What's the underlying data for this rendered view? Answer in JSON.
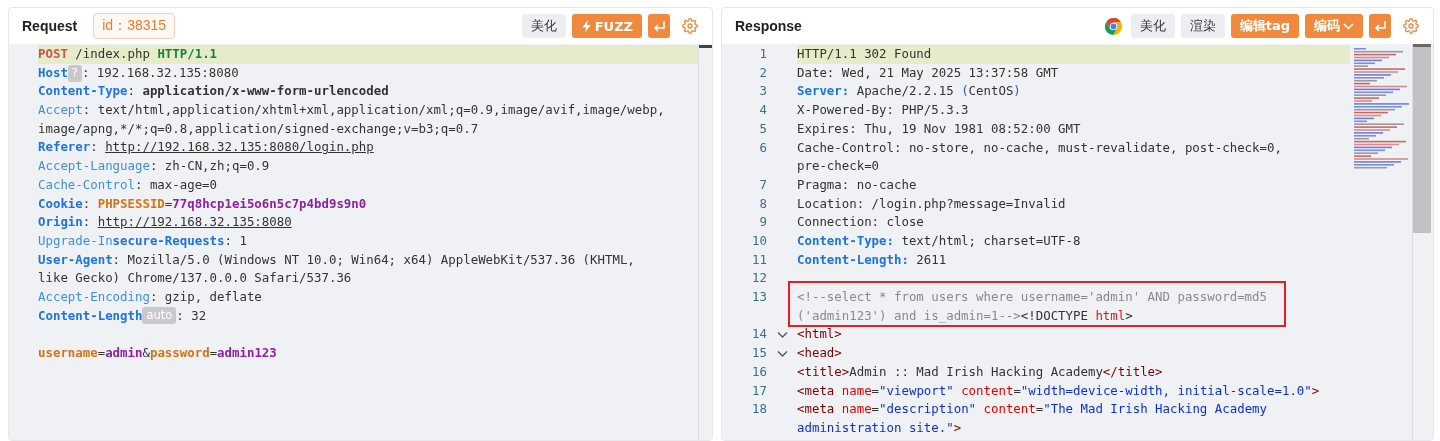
{
  "request": {
    "title": "Request",
    "id_badge": "id：38315",
    "buttons": [
      {
        "kind": "plain",
        "label": "美化"
      },
      {
        "kind": "fuzz",
        "label": "FUZZ"
      },
      {
        "kind": "wrap"
      },
      {
        "kind": "settings"
      }
    ],
    "lines": [
      {
        "highlighted": true,
        "wrapped": [
          [
            {
              "kind": "method",
              "text": "POST"
            },
            {
              "kind": "plain",
              "text": " /index.php "
            },
            {
              "kind": "version",
              "text": "HTTP/1.1"
            }
          ]
        ]
      },
      {
        "highlighted": false,
        "wrapped": [
          [
            {
              "kind": "key-strong",
              "text": "Host"
            },
            {
              "kind": "badge",
              "text": "?"
            },
            {
              "kind": "plain",
              "text": ": 192.168.32.135:8080"
            }
          ]
        ]
      },
      {
        "highlighted": false,
        "wrapped": [
          [
            {
              "kind": "key-strong",
              "text": "Content-Type"
            },
            {
              "kind": "plain",
              "text": ": "
            },
            {
              "kind": "value-strong",
              "text": "application/x-www-form-urlencoded"
            }
          ]
        ]
      },
      {
        "highlighted": false,
        "wrapped": [
          [
            {
              "kind": "key",
              "text": "Accept"
            },
            {
              "kind": "plain",
              "text": ": text/html,application/xhtml+xml,application/xml;q=0.9,image/avif,image/webp,"
            }
          ],
          [
            {
              "kind": "plain",
              "text": "image/apng,*/*;q=0.8,application/signed-exchange;v=b3;q=0.7"
            }
          ]
        ]
      },
      {
        "highlighted": false,
        "wrapped": [
          [
            {
              "kind": "key-strong",
              "text": "Referer"
            },
            {
              "kind": "plain",
              "text": ": "
            },
            {
              "kind": "link",
              "text": "http://192.168.32.135:8080/login.php"
            }
          ]
        ]
      },
      {
        "highlighted": false,
        "wrapped": [
          [
            {
              "kind": "key",
              "text": "Accept-Language"
            },
            {
              "kind": "plain",
              "text": ": zh-CN,zh;q=0.9"
            }
          ]
        ]
      },
      {
        "highlighted": false,
        "wrapped": [
          [
            {
              "kind": "key",
              "text": "Cache-Control"
            },
            {
              "kind": "plain",
              "text": ": max-age=0"
            }
          ]
        ]
      },
      {
        "highlighted": false,
        "wrapped": [
          [
            {
              "kind": "key-strong",
              "text": "Cookie"
            },
            {
              "kind": "plain",
              "text": ": "
            },
            {
              "kind": "cookie-name",
              "text": "PHPSESSID"
            },
            {
              "kind": "plain",
              "text": "="
            },
            {
              "kind": "cookie-value",
              "text": "77q8hcp1ei5o6n5c7p4bd9s9n0"
            }
          ]
        ]
      },
      {
        "highlighted": false,
        "wrapped": [
          [
            {
              "kind": "key-strong",
              "text": "Origin"
            },
            {
              "kind": "plain",
              "text": ": "
            },
            {
              "kind": "link",
              "text": "http://192.168.32.135:8080"
            }
          ]
        ]
      },
      {
        "highlighted": false,
        "wrapped": [
          [
            {
              "kind": "key",
              "text": "Upgrade-In"
            },
            {
              "kind": "key-strong",
              "text": "secure-Requests"
            },
            {
              "kind": "plain",
              "text": ": 1"
            }
          ]
        ]
      },
      {
        "highlighted": false,
        "wrapped": [
          [
            {
              "kind": "key-strong",
              "text": "User-Agent"
            },
            {
              "kind": "plain",
              "text": ": Mozilla/5.0 (Windows NT 10.0; Win64; x64) AppleWebKit/537.36 (KHTML, "
            }
          ],
          [
            {
              "kind": "plain",
              "text": "like Gecko) Chrome/137.0.0.0 Safari/537.36"
            }
          ]
        ]
      },
      {
        "highlighted": false,
        "wrapped": [
          [
            {
              "kind": "key",
              "text": "Accept-Encoding"
            },
            {
              "kind": "plain",
              "text": ": gzip, deflate"
            }
          ]
        ]
      },
      {
        "highlighted": false,
        "wrapped": [
          [
            {
              "kind": "key-strong",
              "text": "Content-Length"
            },
            {
              "kind": "badge",
              "text": "auto"
            },
            {
              "kind": "plain",
              "text": ": 32"
            }
          ]
        ]
      },
      {
        "highlighted": false
      },
      {
        "highlighted": false,
        "wrapped": [
          [
            {
              "kind": "param-name",
              "text": "username"
            },
            {
              "kind": "plain",
              "text": "="
            },
            {
              "kind": "param-value",
              "text": "admin"
            },
            {
              "kind": "plain",
              "text": "&"
            },
            {
              "kind": "param-name",
              "text": "password"
            },
            {
              "kind": "plain",
              "text": "="
            },
            {
              "kind": "param-value",
              "text": "admin123"
            }
          ]
        ]
      }
    ]
  },
  "response": {
    "title": "Response",
    "buttons": [
      {
        "kind": "browser"
      },
      {
        "kind": "plain",
        "label": "美化"
      },
      {
        "kind": "plain",
        "label": "渲染"
      },
      {
        "kind": "accent",
        "label": "编辑tag"
      },
      {
        "kind": "dropdown",
        "label": "编码"
      },
      {
        "kind": "wrap"
      },
      {
        "kind": "settings"
      }
    ],
    "lines": [
      {
        "number": "1",
        "highlighted": true,
        "boxed": false,
        "wrapped": [
          [
            {
              "kind": "plain",
              "text": "HTTP/1.1 302 Found"
            }
          ]
        ]
      },
      {
        "number": "2",
        "highlighted": false,
        "boxed": false,
        "wrapped": [
          [
            {
              "kind": "plain",
              "text": "Date: Wed, 21 May 2025 13:37:58 GMT"
            }
          ]
        ]
      },
      {
        "number": "3",
        "highlighted": false,
        "boxed": false,
        "wrapped": [
          [
            {
              "kind": "key-strong",
              "text": "Server:"
            },
            {
              "kind": "plain",
              "text": " Apache/2.2.15 "
            },
            {
              "kind": "punct",
              "text": "("
            },
            {
              "kind": "plain",
              "text": "CentOS"
            },
            {
              "kind": "punct",
              "text": ")"
            }
          ]
        ]
      },
      {
        "number": "4",
        "highlighted": false,
        "boxed": false,
        "wrapped": [
          [
            {
              "kind": "plain",
              "text": "X-Powered-By: PHP/5.3.3"
            }
          ]
        ]
      },
      {
        "number": "5",
        "highlighted": false,
        "boxed": false,
        "wrapped": [
          [
            {
              "kind": "plain",
              "text": "Expires: Thu, 19 Nov 1981 08:52:00 GMT"
            }
          ]
        ]
      },
      {
        "number": "6",
        "highlighted": false,
        "boxed": false,
        "wrapped": [
          [
            {
              "kind": "plain",
              "text": "Cache-Control: no-store, no-cache, must-revalidate, post-check=0, "
            }
          ],
          [
            {
              "kind": "plain",
              "text": "pre-check=0"
            }
          ]
        ]
      },
      {
        "number": "7",
        "highlighted": false,
        "boxed": false,
        "wrapped": [
          [
            {
              "kind": "plain",
              "text": "Pragma: no-cache"
            }
          ]
        ]
      },
      {
        "number": "8",
        "highlighted": false,
        "boxed": false,
        "wrapped": [
          [
            {
              "kind": "plain",
              "text": "Location: /login.php?message=Invalid"
            }
          ]
        ]
      },
      {
        "number": "9",
        "highlighted": false,
        "boxed": false,
        "wrapped": [
          [
            {
              "kind": "plain",
              "text": "Connection: close"
            }
          ]
        ]
      },
      {
        "number": "10",
        "highlighted": false,
        "boxed": false,
        "wrapped": [
          [
            {
              "kind": "key-strong",
              "text": "Content-Type:"
            },
            {
              "kind": "plain",
              "text": " text/html; charset=UTF-8"
            }
          ]
        ]
      },
      {
        "number": "11",
        "highlighted": false,
        "boxed": false,
        "wrapped": [
          [
            {
              "kind": "key-strong",
              "text": "Content-Length:"
            },
            {
              "kind": "plain",
              "text": " 2611"
            }
          ]
        ]
      },
      {
        "number": "12",
        "highlighted": false,
        "boxed": false
      },
      {
        "number": "13",
        "highlighted": false,
        "boxed": true,
        "wrapped": [
          [
            {
              "kind": "comment",
              "text": "<!--select * from users where username='admin' AND password=md5"
            }
          ],
          [
            {
              "kind": "comment",
              "text": "('admin123') and is_admin=1-->"
            },
            {
              "kind": "plain",
              "text": "<!DOCTYPE "
            },
            {
              "kind": "doctype-name",
              "text": "html"
            },
            {
              "kind": "plain",
              "text": ">"
            }
          ]
        ]
      },
      {
        "number": "14",
        "highlighted": false,
        "boxed": false,
        "expanded": true,
        "wrapped": [
          [
            {
              "kind": "tag",
              "text": "<html>"
            }
          ]
        ]
      },
      {
        "number": "15",
        "highlighted": false,
        "boxed": false,
        "expanded": true,
        "wrapped": [
          [
            {
              "kind": "tag",
              "text": "<head>"
            }
          ]
        ]
      },
      {
        "number": "16",
        "highlighted": false,
        "boxed": false,
        "wrapped": [
          [
            {
              "kind": "tag",
              "text": "<title>"
            },
            {
              "kind": "plain",
              "text": "Admin :: Mad Irish Hacking Academy"
            },
            {
              "kind": "tag",
              "text": "</title>"
            }
          ]
        ]
      },
      {
        "number": "17",
        "highlighted": false,
        "boxed": false,
        "wrapped": [
          [
            {
              "kind": "tag",
              "text": "<meta "
            },
            {
              "kind": "attr",
              "text": "name"
            },
            {
              "kind": "plain",
              "text": "="
            },
            {
              "kind": "string",
              "text": "\"viewport\""
            },
            {
              "kind": "attr",
              "text": " content"
            },
            {
              "kind": "plain",
              "text": "="
            },
            {
              "kind": "string",
              "text": "\"width=device-width, initial-scale=1.0\""
            },
            {
              "kind": "tag",
              "text": ">"
            }
          ]
        ]
      },
      {
        "number": "18",
        "highlighted": false,
        "boxed": false,
        "wrapped": [
          [
            {
              "kind": "tag",
              "text": "<meta "
            },
            {
              "kind": "attr",
              "text": "name"
            },
            {
              "kind": "plain",
              "text": "="
            },
            {
              "kind": "string",
              "text": "\"description\""
            },
            {
              "kind": "attr",
              "text": " content"
            },
            {
              "kind": "plain",
              "text": "="
            },
            {
              "kind": "string",
              "text": "\"The Mad Irish Hacking Academy "
            }
          ],
          [
            {
              "kind": "string",
              "text": "administration site.\""
            },
            {
              "kind": "tag",
              "text": ">"
            }
          ]
        ]
      }
    ]
  }
}
